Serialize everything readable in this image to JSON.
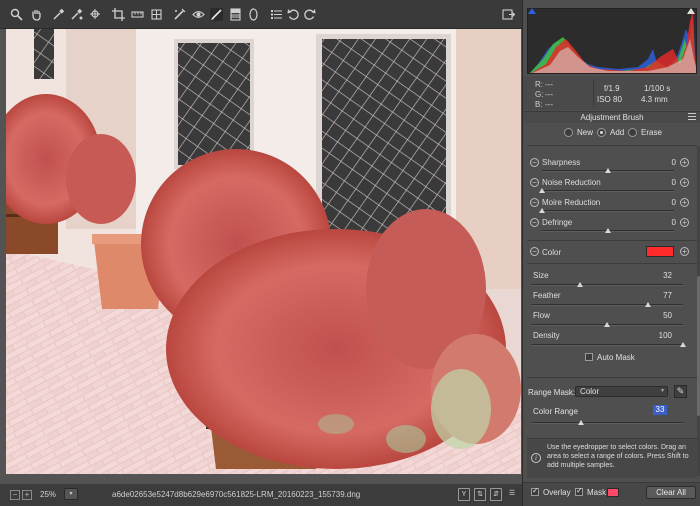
{
  "toolbar": {
    "tools": [
      "zoom-icon",
      "hand-icon",
      "white-balance-icon",
      "color-sampler-icon",
      "targeted-adjustment-icon",
      "crop-icon",
      "straighten-icon",
      "transform-icon",
      "spot-removal-icon",
      "red-eye-icon",
      "adjustment-brush-icon",
      "graduated-filter-icon",
      "radial-filter-icon",
      "presets-icon",
      "rotate-left-icon",
      "rotate-right-icon",
      "open-preferences-icon"
    ]
  },
  "status": {
    "zoom": "25%",
    "filename": "a6de02653e5247d8b629e6970c561825-LRM_20160223_155739.dng"
  },
  "readout": {
    "r_label": "R:",
    "g_label": "G:",
    "b_label": "B:",
    "r_value": "---",
    "g_value": "---",
    "b_value": "---",
    "aperture": "f/1.9",
    "shutter": "1/100 s",
    "iso": "ISO 80",
    "focal": "4.3 mm"
  },
  "adjustment_brush": {
    "title": "Adjustment Brush",
    "modes": [
      "New",
      "Add",
      "Erase"
    ],
    "selected_mode": "Add",
    "sliders": [
      {
        "label": "Sharpness",
        "value": "0",
        "fraction": 0.5
      },
      {
        "label": "Noise Reduction",
        "value": "0",
        "fraction": 0.0
      },
      {
        "label": "Moire Reduction",
        "value": "0",
        "fraction": 0.0
      },
      {
        "label": "Defringe",
        "value": "0",
        "fraction": 0.5
      }
    ],
    "color_label": "Color",
    "color_value": "#ff2b2b",
    "brush": [
      {
        "label": "Size",
        "value": "32",
        "fraction": 0.32
      },
      {
        "label": "Feather",
        "value": "77",
        "fraction": 0.77
      },
      {
        "label": "Flow",
        "value": "50",
        "fraction": 0.5
      },
      {
        "label": "Density",
        "value": "100",
        "fraction": 1.0
      }
    ],
    "auto_mask_label": "Auto Mask",
    "range_mask_label": "Range Mask:",
    "range_mask_value": "Color",
    "color_range_label": "Color Range",
    "color_range_value": "33",
    "color_range_fraction": 0.33,
    "info": "Use the eyedropper to select colors. Drag an area to select a range of colors. Press Shift to add multiple samples.",
    "overlay_label": "Overlay",
    "mask_label": "Mask",
    "mask_color": "#ff4a67",
    "clear_all_label": "Clear All"
  }
}
